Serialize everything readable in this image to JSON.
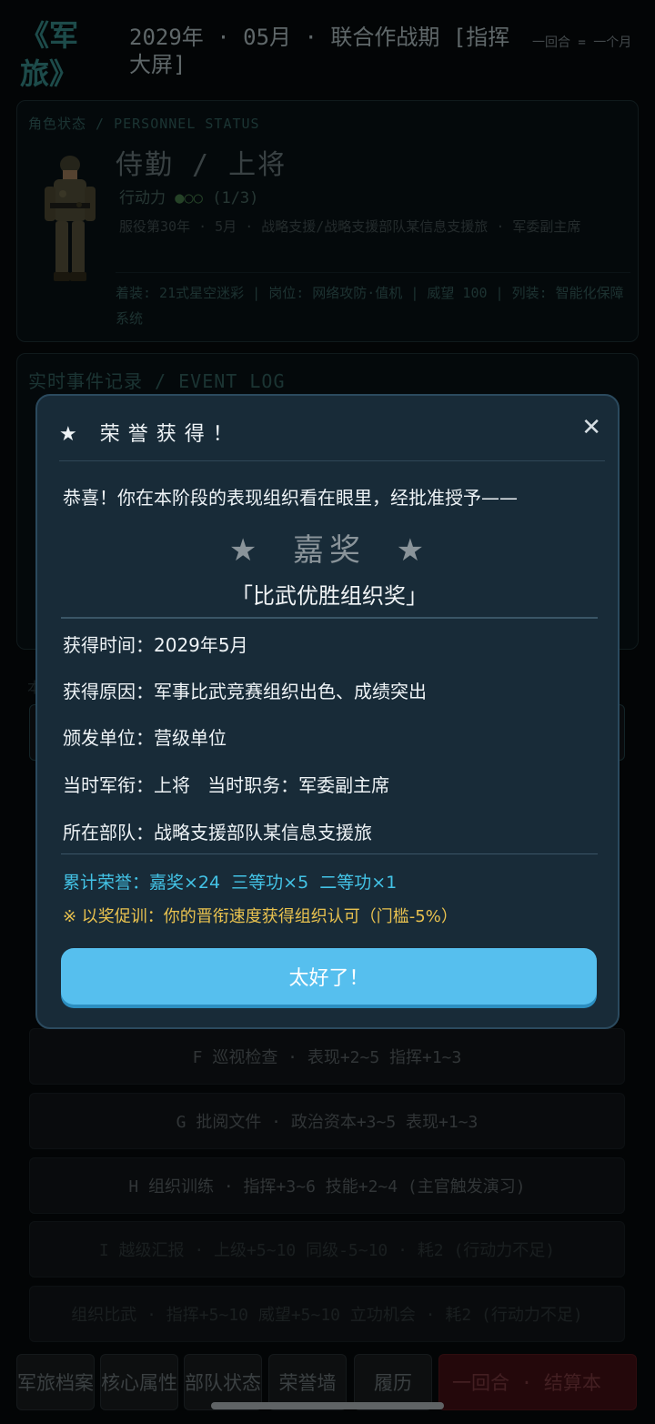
{
  "header": {
    "logo": "《军旅》",
    "date": "2029年 · 05月 · 联合作战期 [指挥大屏]",
    "round_note": "一回合 = 一个月"
  },
  "status": {
    "section_title": "角色状态 / PERSONNEL STATUS",
    "rank_line": "侍勤  /  上将",
    "action_points_label": "行动力",
    "action_points_dots": "●○○",
    "action_points_value": "(1/3)",
    "service_line": "服役第30年 · 5月 · 战略支援/战略支援部队某信息支援旅 · 军委副主席",
    "gear_line": "着装: 21式星空迷彩 | 岗位: 网络攻防·值机 | 威望 100 | 列装: 智能化保障系统"
  },
  "event_log": {
    "title": "实时事件记录 / EVENT LOG"
  },
  "actions": {
    "section_label": "本",
    "items": [
      {
        "label": "F  巡视检查 · 表现+2~5 指挥+1~3"
      },
      {
        "label": "G  批阅文件 · 政治资本+3~5 表现+1~3"
      },
      {
        "label": "H  组织训练 · 指挥+3~6 技能+2~4 (主官触发演习)"
      },
      {
        "label": "I  越级汇报 · 上级+5~10 同级-5~10 · 耗2 (行动力不足)"
      },
      {
        "label": "组织比武 · 指挥+5~10 威望+5~10 立功机会 · 耗2 (行动力不足)"
      }
    ]
  },
  "bottom_nav": {
    "items": [
      "军旅档案",
      "核心属性",
      "部队状态",
      "荣誉墙",
      "履历"
    ],
    "end_round": "一回合 · 结算本"
  },
  "modal": {
    "title": "★ 荣誉获得！",
    "close": "✕",
    "intro": "恭喜！你在本阶段的表现组织看在眼里，经批准授予——",
    "award": "★  嘉奖  ★",
    "award_name": "「比武优胜组织奖」",
    "time_label": "获得时间：",
    "time_value": "2029年5月",
    "reason_label": "获得原因：",
    "reason_value": "军事比武竞赛组织出色、成绩突出",
    "issuer_label": "颁发单位：",
    "issuer_value": "营级单位",
    "rank_label": "当时军衔：",
    "rank_value": "上将",
    "post_label": "当时职务：",
    "post_value": "军委副主席",
    "unit_label": "所在部队：",
    "unit_value": "战略支援部队某信息支援旅",
    "total": "累计荣誉：嘉奖×24  三等功×5  二等功×1",
    "note": "※ 以奖促训：你的晋衔速度获得组织认可（门槛-5%）",
    "confirm": "太好了！"
  },
  "colors": {
    "accent": "#56bfee",
    "teal_text": "#43c3e6",
    "note_gold": "#e9c24f",
    "modal_bg": "#182b38"
  }
}
